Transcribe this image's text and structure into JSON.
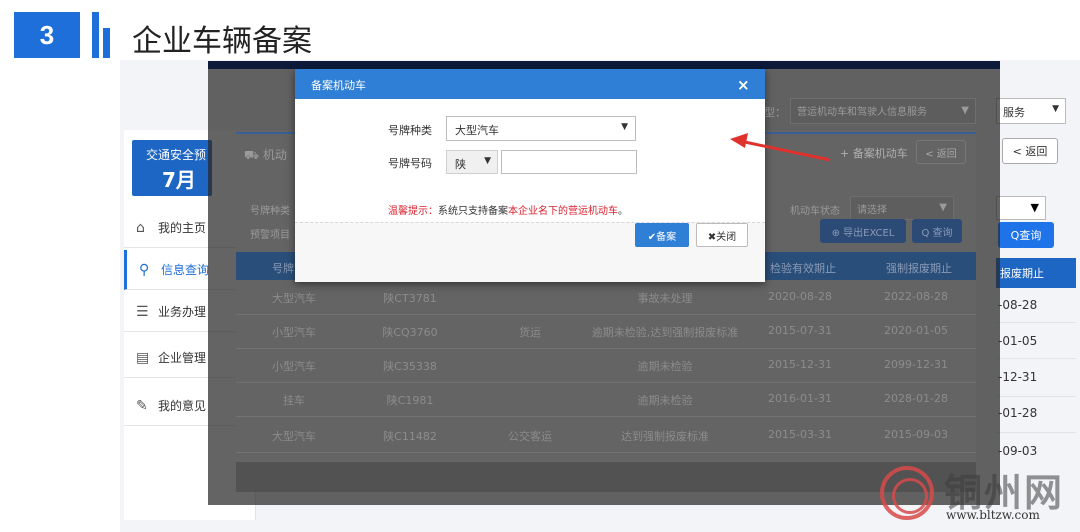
{
  "slide": {
    "number": "3",
    "title": "企业车辆备案"
  },
  "background": {
    "brand_card": {
      "line1": "交通安全预",
      "line2": "7月"
    },
    "nav": [
      {
        "label": "我的主页",
        "icon": "home-icon"
      },
      {
        "label": "信息查询",
        "icon": "search-icon",
        "active": true
      },
      {
        "label": "业务办理",
        "icon": "stack-icon"
      },
      {
        "label": "企业管理",
        "icon": "document-icon"
      },
      {
        "label": "我的意见",
        "icon": "feedback-icon"
      }
    ],
    "service_select": "营运机动车和驾驶人信息服务",
    "service_select_label": "型：",
    "service_select_right": "服务",
    "panel_title": "机动",
    "add_vehicle_button": "+ 备案机动车",
    "back_button": "< 返回",
    "back_button_right": "< 返回",
    "filter_plate_type": "号牌种类",
    "filter_warning": "预警项目",
    "filter_status_label": "机动车状态",
    "filter_status_value": "请选择",
    "export_button": "⊕ 导出EXCEL",
    "query_button": "Q 查询",
    "query_button_right": "Q查询",
    "table_headers": [
      "号牌",
      "检验有效期止",
      "强制报废期止"
    ],
    "table_header_right": "报废期止",
    "rows": [
      {
        "type": "大型汽车",
        "plate": "陕CT3781",
        "usage": "",
        "status": "事故未处理",
        "inspect": "2020-08-28",
        "scrap": "2022-08-28"
      },
      {
        "type": "小型汽车",
        "plate": "陕CQ3760",
        "usage": "货运",
        "status": "逾期未检验,达到强制报废标准",
        "inspect": "2015-07-31",
        "scrap": "2020-01-05"
      },
      {
        "type": "小型汽车",
        "plate": "陕C35338",
        "usage": "",
        "status": "逾期未检验",
        "inspect": "2015-12-31",
        "scrap": "2099-12-31"
      },
      {
        "type": "挂车",
        "plate": "陕C1981",
        "usage": "",
        "status": "逾期未检验",
        "inspect": "2016-01-31",
        "scrap": "2028-01-28"
      },
      {
        "type": "大型汽车",
        "plate": "陕C11482",
        "usage": "公交客运",
        "status": "达到强制报废标准",
        "inspect": "2015-03-31",
        "scrap": "2015-09-03"
      }
    ],
    "right_dates": [
      "-08-28",
      "-01-05",
      "-12-31",
      "-01-28",
      "-09-03"
    ]
  },
  "modal": {
    "title": "备案机动车",
    "close_label": "×",
    "plate_type_label": "号牌种类",
    "plate_type_value": "大型汽车",
    "plate_number_label": "号牌号码",
    "province_value": "陕",
    "plate_number_value": "",
    "tip_prefix": "温馨提示：",
    "tip_middle": "系统只支持备案",
    "tip_highlight": "本企业名下的营运机动车",
    "tip_end": "。",
    "file_button": "✔备案",
    "close_button": "✖关闭"
  },
  "watermark": {
    "name": "铜州网",
    "url": "www.bltzw.com"
  },
  "colors": {
    "accent": "#1e6fd9",
    "modal_header": "#2f7fd6",
    "tip_red": "#d9232f",
    "arrow_red": "#e0322c"
  }
}
